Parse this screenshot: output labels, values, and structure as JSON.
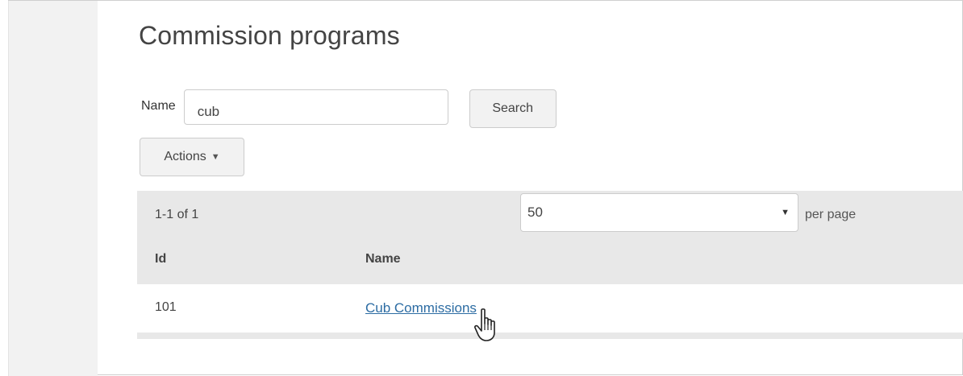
{
  "page": {
    "title": "Commission programs"
  },
  "search": {
    "name_label": "Name",
    "name_value": "cub",
    "search_button": "Search"
  },
  "toolbar": {
    "actions_label": "Actions",
    "actions_caret": "▼"
  },
  "grid": {
    "count_text": "1-1 of 1",
    "per_page_value": "50",
    "per_page_arrow": "▼",
    "per_page_label": "per page",
    "columns": [
      "Id",
      "Name"
    ],
    "rows": [
      {
        "id": "101",
        "name": "Cub Commissions"
      }
    ]
  },
  "icons": {
    "cursor": "hand-pointer-icon"
  },
  "colors": {
    "link": "#2c6ca3",
    "header_bg": "#e8e8e8",
    "rail_bg": "#f2f2f2"
  }
}
